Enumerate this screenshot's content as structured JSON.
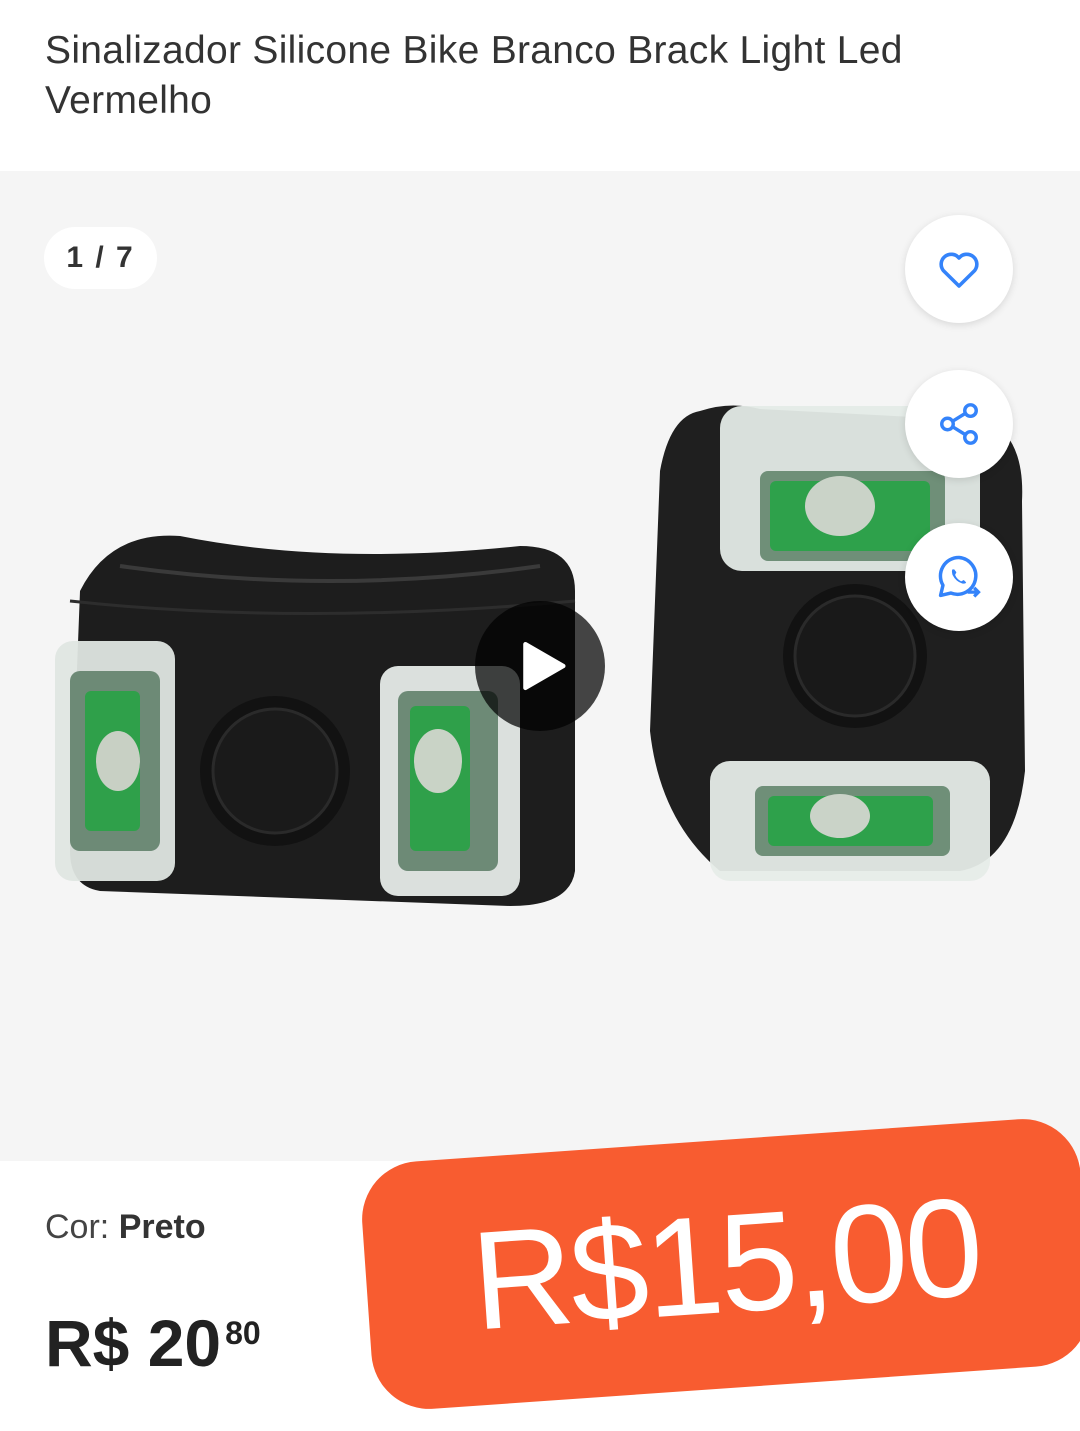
{
  "product": {
    "title": "Sinalizador Silicone Bike Branco Brack Light Led Vermelho"
  },
  "gallery": {
    "counter": "1 / 7",
    "icons": {
      "favorite": "heart-icon",
      "share": "share-icon",
      "whatsapp": "whatsapp-icon",
      "video": "play-icon"
    }
  },
  "details": {
    "color_label": "Cor:",
    "color_value": "Preto",
    "price_currency_whole": "R$ 20",
    "price_cents": "80"
  },
  "sticker": {
    "price": "R$15,00",
    "color": "#f85c30"
  },
  "colors": {
    "accent": "#3483fa"
  }
}
